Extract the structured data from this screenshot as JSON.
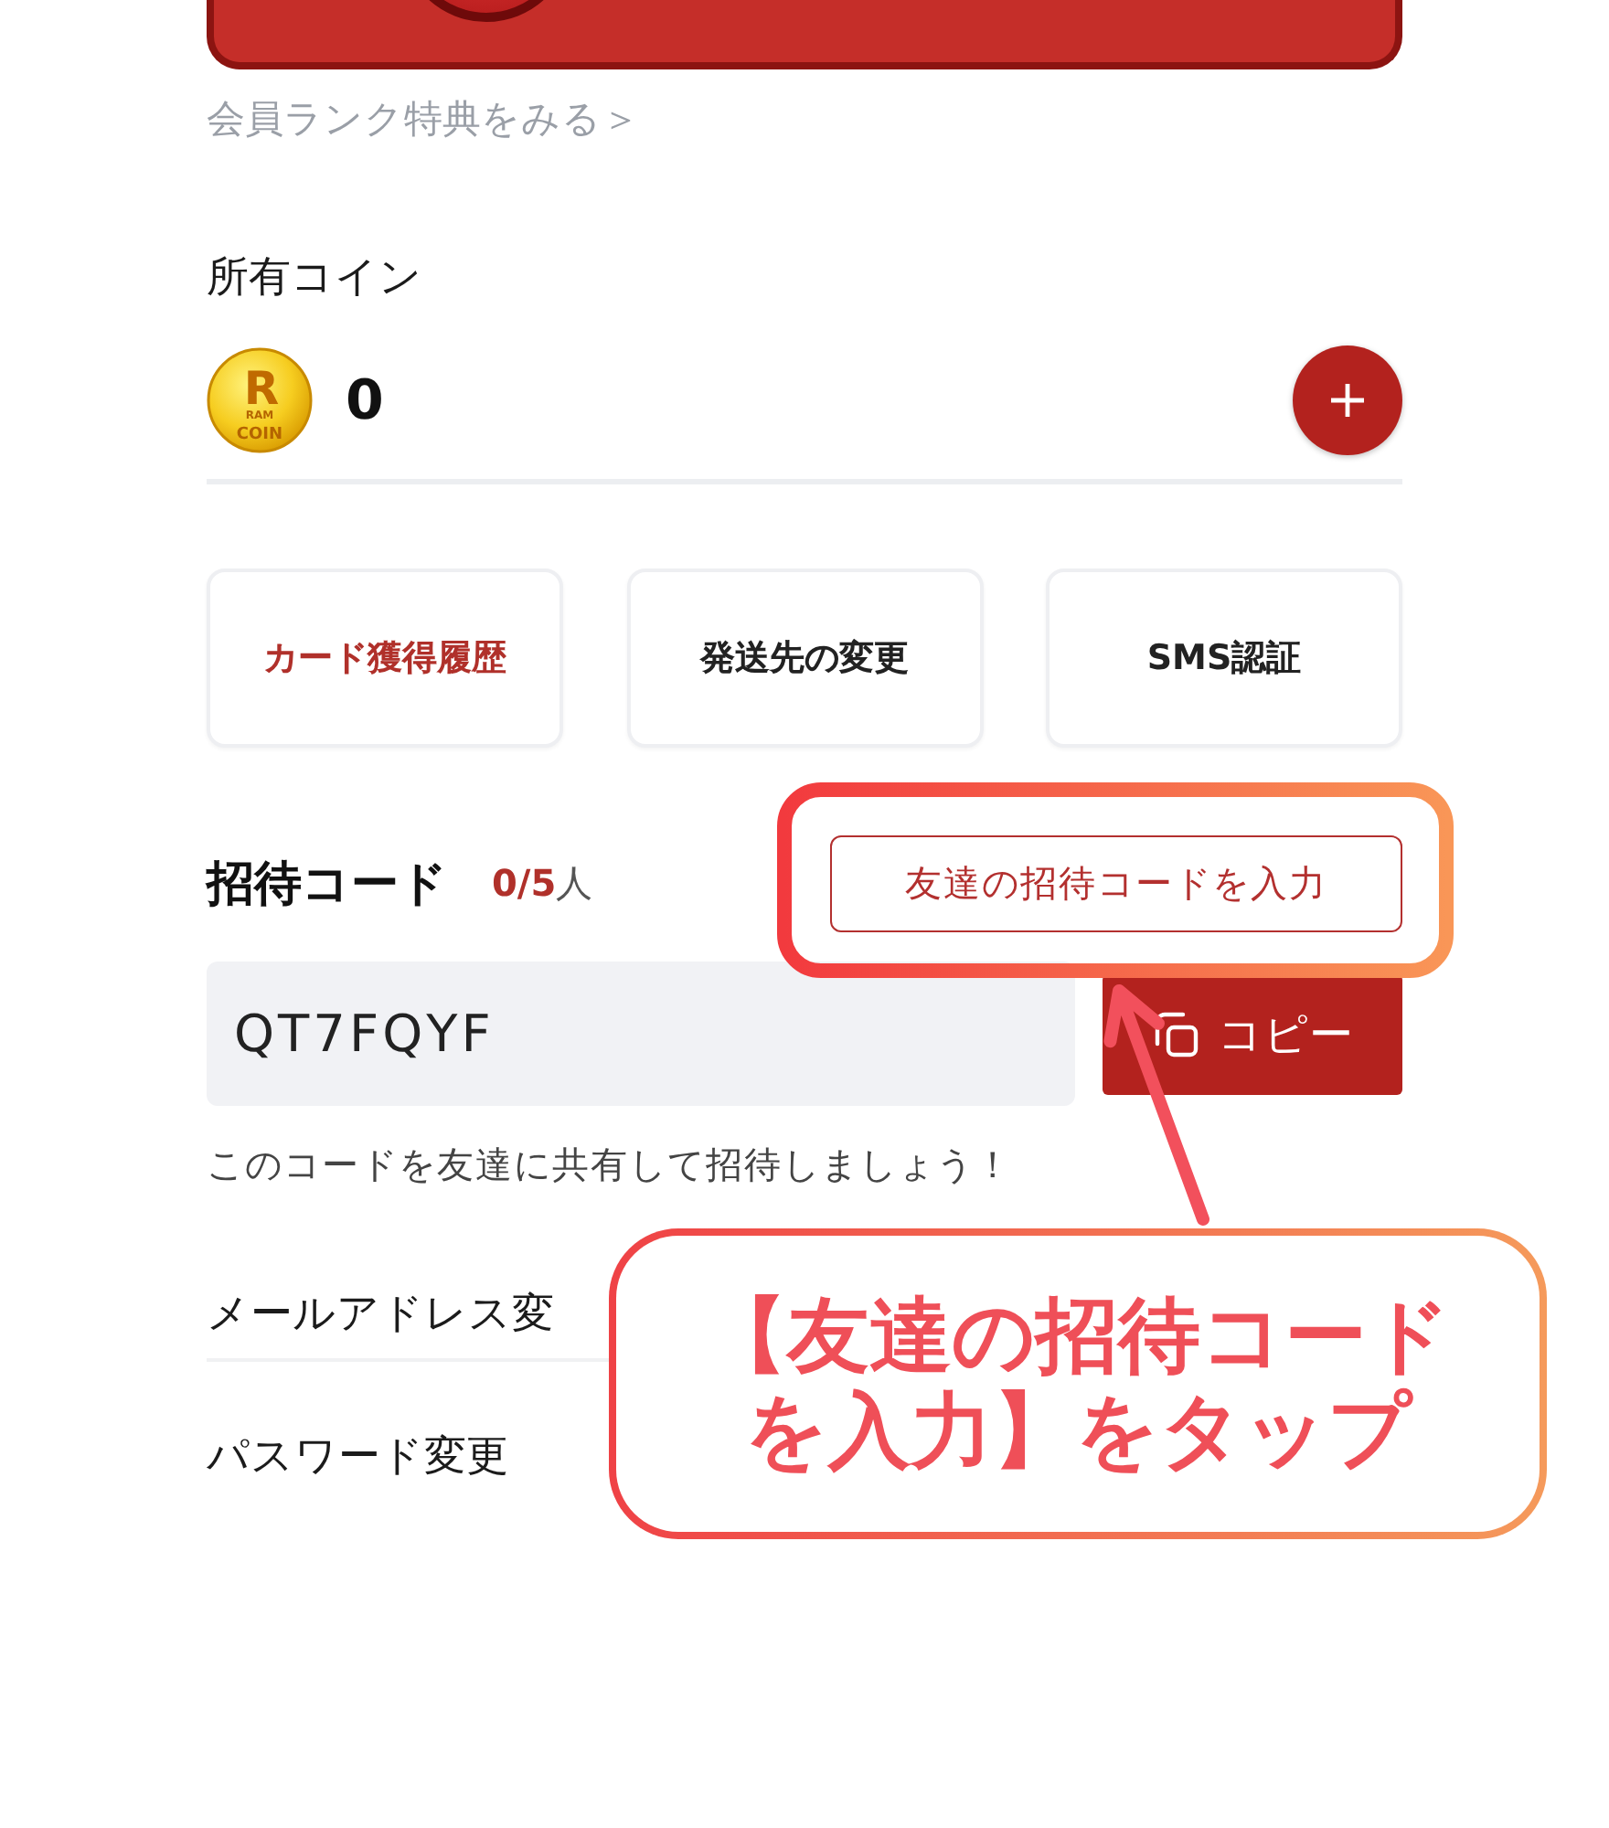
{
  "rank_link": "会員ランク特典をみる＞",
  "coins": {
    "title": "所有コイン",
    "logo": {
      "letter": "R",
      "top": "RAM",
      "bottom": "COIN"
    },
    "amount": "0"
  },
  "actions": [
    {
      "label": "カード獲得履歴",
      "highlighted": true
    },
    {
      "label": "発送先の変更",
      "highlighted": false
    },
    {
      "label": "SMS認証",
      "highlighted": false
    }
  ],
  "invite": {
    "title": "招待コード",
    "count": "**0/5**人",
    "enter_button": "友達の招待コードを入力",
    "code": "QT7FQYF",
    "copy_button": "コピー",
    "hint": "このコードを友達に共有して招待しましょう！"
  },
  "settings": [
    {
      "label": "メールアドレス変"
    },
    {
      "label": "パスワード変更"
    }
  ],
  "annotation": {
    "text": "【友達の招待コードを入力】をタップ"
  }
}
